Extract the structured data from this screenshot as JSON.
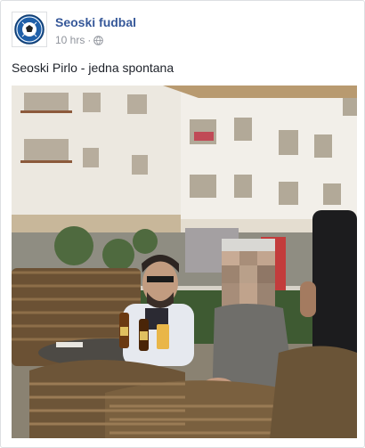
{
  "post": {
    "author": "Seoski fudbal",
    "timestamp": "10 hrs",
    "separator": "·",
    "privacy_icon": "globe-icon",
    "text": "Seoski Pirlo - jedna spontana",
    "avatar_icon": "football-club-logo",
    "photo_description_icon": "post-photo"
  },
  "colors": {
    "author_link": "#365899",
    "meta_text": "#90949c",
    "body_text": "#1d2129",
    "border": "#dddfe2"
  }
}
